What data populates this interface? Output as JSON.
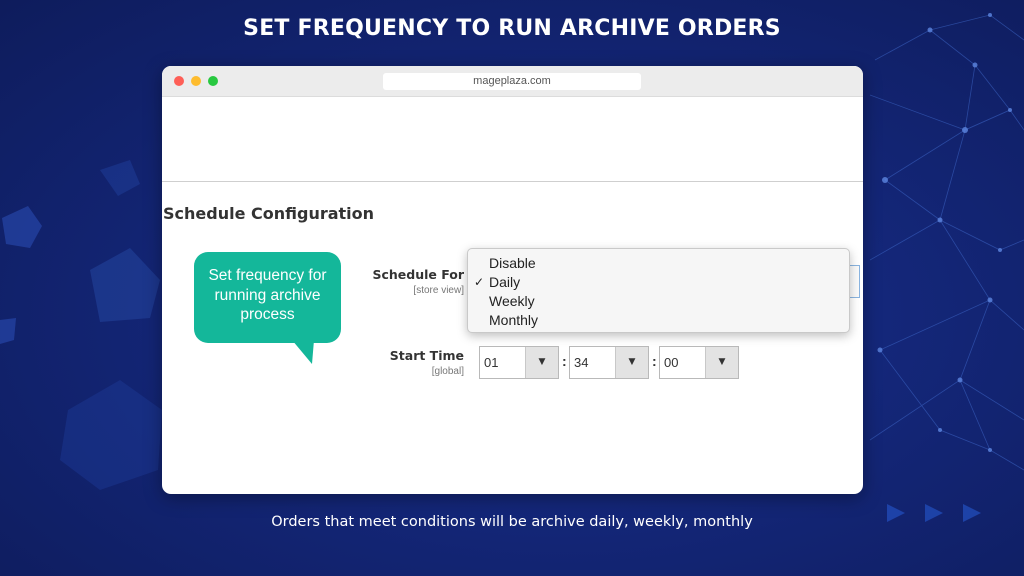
{
  "slide": {
    "title": "SET FREQUENCY TO RUN ARCHIVE ORDERS",
    "caption": "Orders that meet conditions will be archive daily, weekly, monthly"
  },
  "browser": {
    "url": "mageplaza.com"
  },
  "config": {
    "section_title": "Schedule Configuration",
    "callout": "Set frequency for running archive process",
    "schedule_for": {
      "label": "Schedule For",
      "scope": "[store view]",
      "options": [
        "Disable",
        "Daily",
        "Weekly",
        "Monthly"
      ],
      "selected": "Daily",
      "check_icon": "✓"
    },
    "start_time": {
      "label": "Start Time",
      "scope": "[global]",
      "hour": "01",
      "minute": "34",
      "second": "00",
      "separator": ":"
    }
  },
  "colors": {
    "background": "#14277a",
    "callout": "#14b79a",
    "window_dot_red": "#fe5f57",
    "window_dot_yellow": "#febc2e",
    "window_dot_green": "#28c840"
  }
}
